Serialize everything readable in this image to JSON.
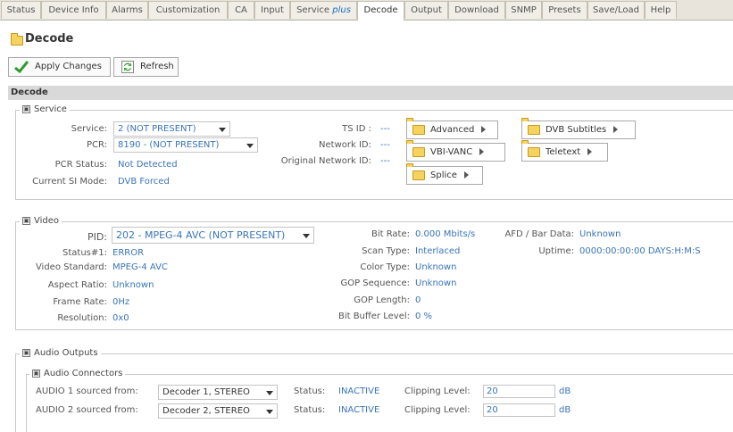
{
  "tabs": [
    {
      "label": "Status"
    },
    {
      "label": "Device Info"
    },
    {
      "label": "Alarms"
    },
    {
      "label": "Customization"
    },
    {
      "label": "CA"
    },
    {
      "label": "Input"
    },
    {
      "label": "Service",
      "suffix": "plus"
    },
    {
      "label": "Decode"
    },
    {
      "label": "Output"
    },
    {
      "label": "Download"
    },
    {
      "label": "SNMP"
    },
    {
      "label": "Presets"
    },
    {
      "label": "Save/Load"
    },
    {
      "label": "Help"
    }
  ],
  "active_tab": "Decode",
  "page_title": "Decode",
  "toolbar": {
    "apply_label": "Apply Changes",
    "refresh_label": "Refresh"
  },
  "section_title": "Decode",
  "service": {
    "legend": "Service",
    "service_label": "Service:",
    "service_value": "2 (NOT PRESENT)",
    "pcr_label": "PCR:",
    "pcr_value": "8190 - (NOT PRESENT)",
    "pcr_status_label": "PCR Status:",
    "pcr_status_value": "Not Detected",
    "si_mode_label": "Current SI Mode:",
    "si_mode_value": "DVB Forced",
    "ts_id_label": "TS ID :",
    "ts_id_value": "---",
    "network_id_label": "Network ID:",
    "network_id_value": "---",
    "orig_network_id_label": "Original Network ID:",
    "orig_network_id_value": "---",
    "buttons": {
      "advanced": "Advanced",
      "dvb_subtitles": "DVB Subtitles",
      "vbi_vanc": "VBI-VANC",
      "teletext": "Teletext",
      "splice": "Splice"
    }
  },
  "video": {
    "legend": "Video",
    "pid_label": "PID:",
    "pid_value": "202 - MPEG-4 AVC (NOT PRESENT)",
    "status_label": "Status#1:",
    "status_value": "ERROR",
    "standard_label": "Video Standard:",
    "standard_value": "MPEG-4 AVC",
    "aspect_label": "Aspect Ratio:",
    "aspect_value": "Unknown",
    "frame_label": "Frame Rate:",
    "frame_value": "0Hz",
    "res_label": "Resolution:",
    "res_value": "0x0",
    "bitrate_label": "Bit Rate:",
    "bitrate_value": "0.000 Mbits/s",
    "scan_label": "Scan Type:",
    "scan_value": "Interlaced",
    "color_label": "Color Type:",
    "color_value": "Unknown",
    "gop_seq_label": "GOP Sequence:",
    "gop_seq_value": "Unknown",
    "gop_len_label": "GOP Length:",
    "gop_len_value": "0",
    "bitbuf_label": "Bit Buffer Level:",
    "bitbuf_value": "0 %",
    "afd_label": "AFD / Bar Data:",
    "afd_value": "Unknown",
    "uptime_label": "Uptime:",
    "uptime_value": "0000:00:00:00 DAYS:H:M:S"
  },
  "audio": {
    "legend": "Audio Outputs",
    "connectors_legend": "Audio Connectors",
    "rows": [
      {
        "label": "AUDIO 1 sourced from:",
        "source": "Decoder 1, STEREO",
        "status_label": "Status:",
        "status": "INACTIVE",
        "clip_label": "Clipping Level:",
        "clip": "20",
        "unit": "dB"
      },
      {
        "label": "AUDIO 2 sourced from:",
        "source": "Decoder 2, STEREO",
        "status_label": "Status:",
        "status": "INACTIVE",
        "clip_label": "Clipping Level:",
        "clip": "20",
        "unit": "dB"
      }
    ]
  },
  "colors": {
    "accent": "#3a74b8",
    "tabbar": "#e8e4dc",
    "section": "#d9d9d9",
    "folder": "#f6d35e"
  }
}
